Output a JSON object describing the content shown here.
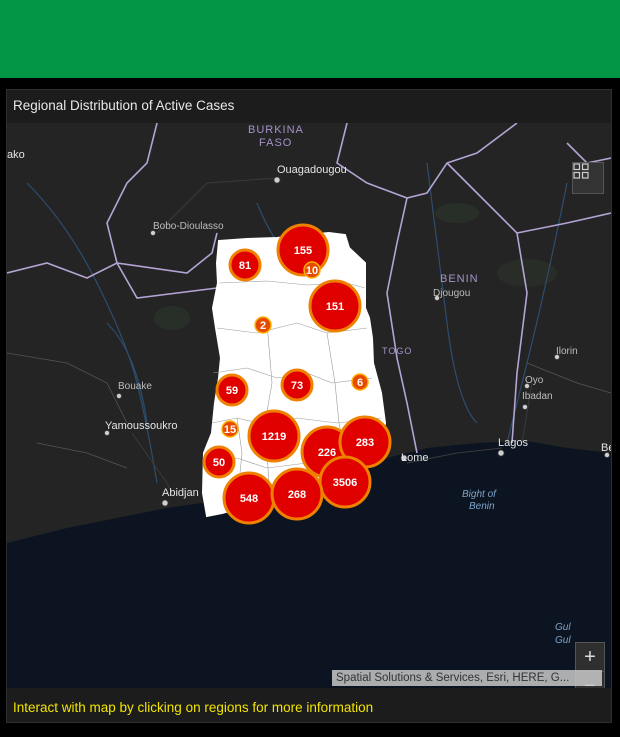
{
  "panel": {
    "title": "Regional Distribution of Active Cases",
    "footer": "Interact with map by clicking on regions for more information"
  },
  "map": {
    "attribution": "Spatial Solutions & Services, Esri, HERE, G...",
    "zoom_in": "+",
    "zoom_out": "−",
    "countries": {
      "burkina1": "BURKINA",
      "burkina2": "FASO",
      "benin": "BENIN",
      "togo": "TOGO"
    },
    "places": {
      "ouagadougou": "Ouagadougou",
      "bobo": "Bobo-Dioulasso",
      "djougou": "Djougou",
      "ilorin": "Ilorin",
      "oyo": "Oyo",
      "ibadan": "Ibadan",
      "bouake": "Bouake",
      "yamoussoukro": "Yamoussoukro",
      "abidjan": "Abidjan",
      "lome": "Lome",
      "lagos": "Lagos",
      "ako": "ako",
      "be": "Be"
    },
    "water": {
      "bight1": "Bight of",
      "bight2": "Benin",
      "gulf1": "Gul",
      "gulf2": "Gul"
    },
    "clusters": [
      {
        "value": "155",
        "size": "large"
      },
      {
        "value": "81",
        "size": "medium"
      },
      {
        "value": "10",
        "size": "small"
      },
      {
        "value": "151",
        "size": "large"
      },
      {
        "value": "2",
        "size": "small"
      },
      {
        "value": "73",
        "size": "medium"
      },
      {
        "value": "6",
        "size": "small"
      },
      {
        "value": "59",
        "size": "medium"
      },
      {
        "value": "15",
        "size": "small"
      },
      {
        "value": "1219",
        "size": "large"
      },
      {
        "value": "226",
        "size": "large"
      },
      {
        "value": "283",
        "size": "large"
      },
      {
        "value": "50",
        "size": "medium"
      },
      {
        "value": "3506",
        "size": "large"
      },
      {
        "value": "548",
        "size": "large"
      },
      {
        "value": "268",
        "size": "large"
      }
    ]
  }
}
